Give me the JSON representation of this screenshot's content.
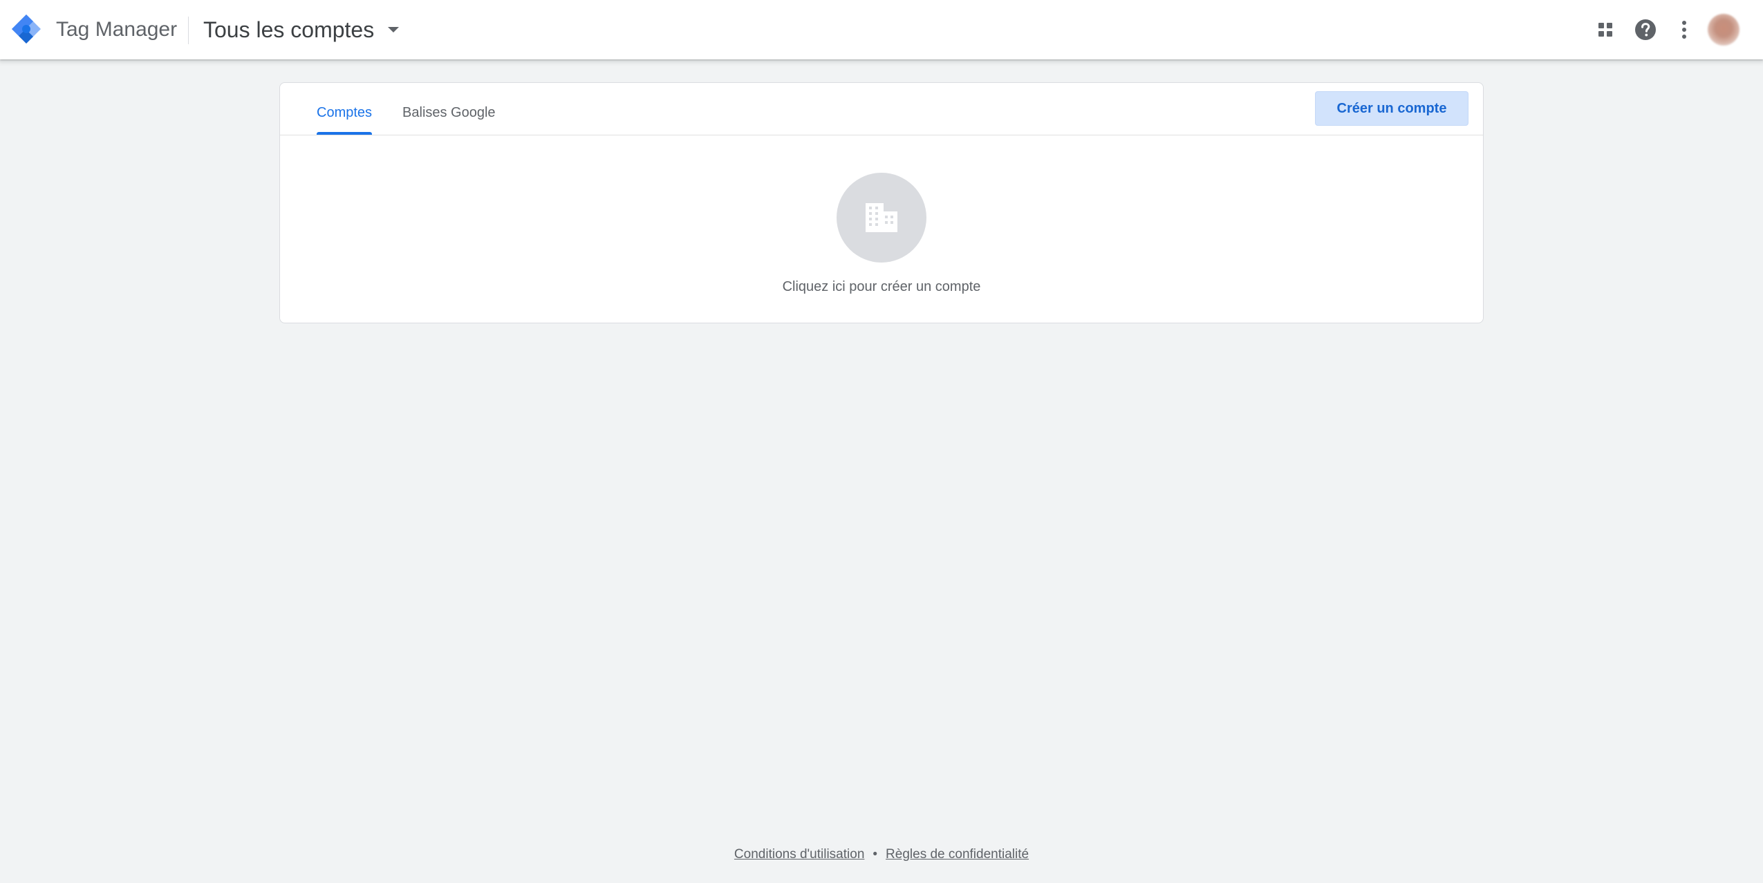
{
  "header": {
    "product_name": "Tag Manager",
    "account_switcher_label": "Tous les comptes",
    "icons": {
      "logo": "tag-manager-logo-icon",
      "apps": "apps-grid-icon",
      "help": "help-icon",
      "more": "more-vert-icon",
      "avatar": "avatar"
    }
  },
  "tabs": [
    {
      "label": "Comptes",
      "active": true
    },
    {
      "label": "Balises Google",
      "active": false
    }
  ],
  "toolbar": {
    "create_account_label": "Créer un compte"
  },
  "empty_state": {
    "icon": "building-icon",
    "label": "Cliquez ici pour créer un compte"
  },
  "footer": {
    "terms_label": "Conditions d'utilisation",
    "separator": "•",
    "privacy_label": "Règles de confidentialité"
  },
  "colors": {
    "accent": "#1a73e8",
    "background": "#f1f3f4",
    "button_bg": "#d2e3fc",
    "logo_dark": "#1967d2",
    "logo_light": "#8ab4f8"
  }
}
